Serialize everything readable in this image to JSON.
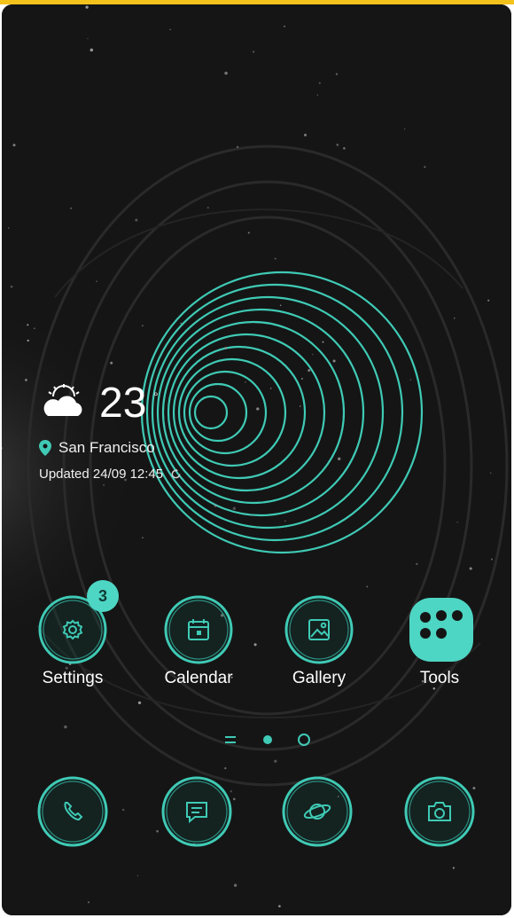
{
  "weather": {
    "temperature": "23",
    "degree_symbol": "°",
    "location": "San Francisco",
    "updated": "Updated 24/09 12:45",
    "icon": "partly-cloudy-icon"
  },
  "apps": [
    {
      "label": "Settings",
      "icon": "gear-icon",
      "badge": "3"
    },
    {
      "label": "Calendar",
      "icon": "calendar-icon"
    },
    {
      "label": "Gallery",
      "icon": "gallery-icon"
    },
    {
      "label": "Tools",
      "icon": "tools-folder-icon"
    }
  ],
  "dock": [
    {
      "icon": "phone-icon"
    },
    {
      "icon": "message-icon"
    },
    {
      "icon": "internet-icon"
    },
    {
      "icon": "camera-icon"
    }
  ],
  "pager": {
    "current_page": 2,
    "indicators": [
      "menu-lines-icon",
      "dot-filled-icon",
      "dot-outline-icon"
    ]
  },
  "theme": {
    "accent": "#3fcab5",
    "background": "#151515",
    "top_bar": "#f3c21b"
  }
}
